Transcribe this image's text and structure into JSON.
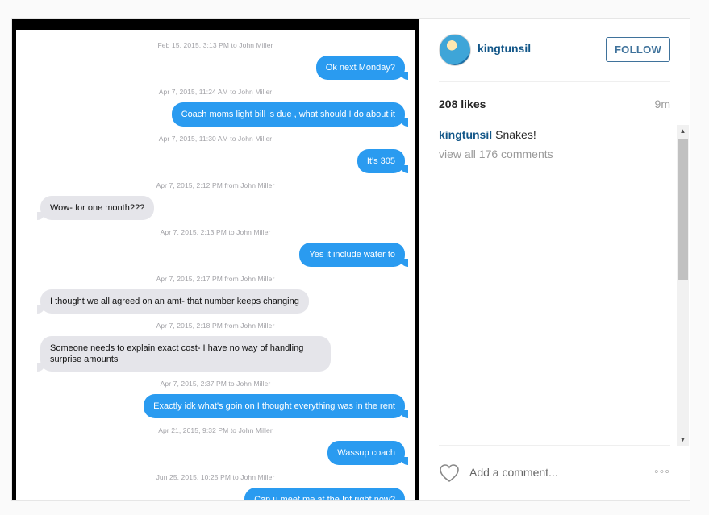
{
  "photo": {
    "messages": [
      {
        "ts": "Feb 15, 2015, 3:13 PM to John Miller",
        "side": "sent",
        "text": "Ok next Monday?"
      },
      {
        "ts": "Apr 7, 2015, 11:24 AM to John Miller",
        "side": "sent",
        "text": "Coach moms light bill is due , what should I do about it"
      },
      {
        "ts": "Apr 7, 2015, 11:30 AM to John Miller",
        "side": "sent",
        "text": "It's 305"
      },
      {
        "ts": "Apr 7, 2015, 2:12 PM from John Miller",
        "side": "recv",
        "text": "Wow- for one month???"
      },
      {
        "ts": "Apr 7, 2015, 2:13 PM to John Miller",
        "side": "sent",
        "text": "Yes it include water to"
      },
      {
        "ts": "Apr 7, 2015, 2:17 PM from John Miller",
        "side": "recv",
        "text": "I thought we all agreed on an amt- that number keeps changing"
      },
      {
        "ts": "Apr 7, 2015, 2:18 PM from John Miller",
        "side": "recv",
        "text": "Someone needs to explain exact cost- I have no way of handling surprise amounts"
      },
      {
        "ts": "Apr 7, 2015, 2:37 PM to John Miller",
        "side": "sent",
        "text": "Exactly idk what's goin on I thought everything was in the rent"
      },
      {
        "ts": "Apr 21, 2015, 9:32 PM to John Miller",
        "side": "sent",
        "text": "Wassup coach"
      },
      {
        "ts": "Jun 25, 2015, 10:25 PM to John Miller",
        "side": "sent",
        "text": "Can u meet me at the Inf right now?"
      }
    ]
  },
  "header": {
    "username": "kingtunsil",
    "follow_label": "FOLLOW"
  },
  "stats": {
    "likes": "208 likes",
    "time": "9m"
  },
  "caption": {
    "user": "kingtunsil",
    "text": "Snakes!"
  },
  "comments": {
    "view_all": "view all 176 comments"
  },
  "footer": {
    "comment_placeholder": "Add a comment...",
    "more": "◦◦◦"
  },
  "colors": {
    "sent_bubble": "#2a9bf0",
    "recv_bubble": "#e5e5ea",
    "link": "#125688",
    "follow": "#3f729b"
  },
  "icons": {
    "heart": "heart-icon",
    "more": "more-options-icon",
    "scroll_up": "scroll-up-icon",
    "scroll_down": "scroll-down-icon"
  }
}
